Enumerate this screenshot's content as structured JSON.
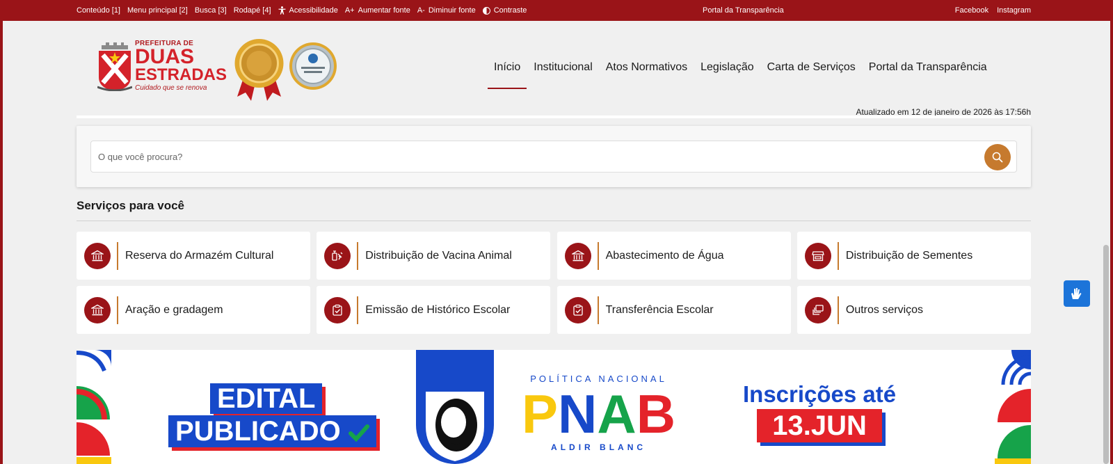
{
  "topbar": {
    "shortcuts": [
      {
        "label": "Conteúdo [1]"
      },
      {
        "label": "Menu principal [2]"
      },
      {
        "label": "Busca [3]"
      },
      {
        "label": "Rodapé [4]"
      }
    ],
    "accessibility": "Acessibilidade",
    "increase_font_glyph": "A+",
    "increase_font": "Aumentar fonte",
    "decrease_font_glyph": "A-",
    "decrease_font": "Diminuir fonte",
    "contrast": "Contraste",
    "transparency_link": "Portal da Transparência",
    "social": [
      {
        "label": "Facebook"
      },
      {
        "label": "Instagram"
      }
    ]
  },
  "logo": {
    "line1": "PREFEITURA DE",
    "line2": "DUAS",
    "line3": "ESTRADAS",
    "tagline": "Cuidado que se renova"
  },
  "nav": {
    "items": [
      {
        "label": "Início",
        "active": true
      },
      {
        "label": "Institucional"
      },
      {
        "label": "Atos Normativos"
      },
      {
        "label": "Legislação"
      },
      {
        "label": "Carta de Serviços"
      },
      {
        "label": "Portal da Transparência"
      }
    ]
  },
  "updated": "Atualizado em 12 de janeiro de 2026 às 17:56h",
  "search": {
    "placeholder": "O que você procura?",
    "value": ""
  },
  "services": {
    "title": "Serviços para você",
    "items": [
      {
        "label": "Reserva do Armazém Cultural",
        "icon": "bank-icon"
      },
      {
        "label": "Distribuição de Vacina Animal",
        "icon": "vaccine-icon"
      },
      {
        "label": "Abastecimento de Água",
        "icon": "bank-icon"
      },
      {
        "label": "Distribuição de Sementes",
        "icon": "store-icon"
      },
      {
        "label": "Aração e gradagem",
        "icon": "bank-icon"
      },
      {
        "label": "Emissão de Histórico Escolar",
        "icon": "clipboard-check-icon"
      },
      {
        "label": "Transferência Escolar",
        "icon": "clipboard-check-icon"
      },
      {
        "label": "Outros serviços",
        "icon": "stack-icon"
      }
    ]
  },
  "banner": {
    "edital_line1": "EDITAL",
    "edital_line2": "PUBLICADO",
    "pnab_top": "POLÍTICA NACIONAL",
    "pnab_letters": [
      "P",
      "N",
      "A",
      "B"
    ],
    "pnab_bottom": "ALDIR BLANC",
    "inscricoes_line1": "Inscrições até",
    "inscricoes_line2": "13.JUN"
  },
  "colors": {
    "brand_red": "#9a1418",
    "accent_orange": "#c67a2e",
    "banner_blue": "#1749c9",
    "banner_red": "#e4232a",
    "banner_yellow": "#f9c80e",
    "banner_green": "#16a34a",
    "vlibras_blue": "#1c74d9"
  }
}
